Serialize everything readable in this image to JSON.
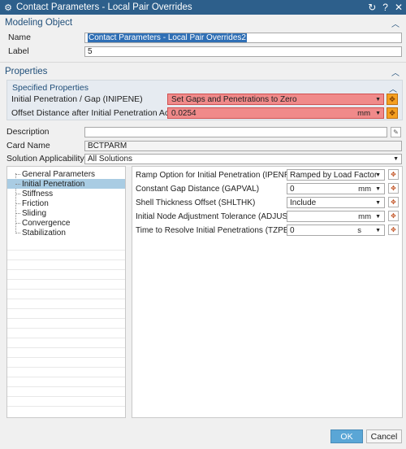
{
  "window": {
    "title": "Contact Parameters - Local Pair Overrides",
    "reset_icon": "reset-icon",
    "help_label": "?",
    "close_label": "✕"
  },
  "modeling_object": {
    "header": "Modeling Object",
    "name_label": "Name",
    "name_value": "Contact Parameters - Local Pair Overrides2",
    "label_label": "Label",
    "label_value": "5"
  },
  "properties": {
    "header": "Properties",
    "specified_header": "Specified Properties",
    "ipene_label": "Initial Penetration / Gap (INIPENE)",
    "ipene_value": "Set Gaps and Penetrations to Zero",
    "offset_label": "Offset Distance after Initial Penetration Action (OFFSET)",
    "offset_value": "0.0254",
    "offset_unit": "mm",
    "description_label": "Description",
    "description_value": "",
    "card_name_label": "Card Name",
    "card_name_value": "BCTPARM",
    "applicability_label": "Solution Applicability View",
    "applicability_value": "All Solutions"
  },
  "tree": {
    "items": [
      {
        "label": "General Parameters"
      },
      {
        "label": "Initial Penetration"
      },
      {
        "label": "Stiffness"
      },
      {
        "label": "Friction"
      },
      {
        "label": "Sliding"
      },
      {
        "label": "Convergence"
      },
      {
        "label": "Stabilization"
      }
    ],
    "selected_index": 1
  },
  "pane": {
    "ipenramp_label": "Ramp Option for Initial Penetration (IPENRAMP)",
    "ipenramp_value": "Ramped by Load Factor",
    "gapval_label": "Constant Gap Distance (GAPVAL)",
    "gapval_value": "0",
    "gapval_unit": "mm",
    "shlthk_label": "Shell Thickness Offset (SHLTHK)",
    "shlthk_value": "Include",
    "adjust_label": "Initial Node Adjustment Tolerance (ADJUST)",
    "adjust_value": "",
    "adjust_unit": "mm",
    "tzpene_label": "Time to Resolve Initial Penetrations (TZPENE)",
    "tzpene_value": "0",
    "tzpene_unit": "s"
  },
  "footer": {
    "ok_label": "OK",
    "cancel_label": "Cancel"
  },
  "colors": {
    "titlebar": "#2d5f8b",
    "highlight_red": "#f08a8a",
    "orange_button": "#f5a020",
    "tree_selected": "#a9cce3",
    "ok_button": "#5aa6d6"
  }
}
